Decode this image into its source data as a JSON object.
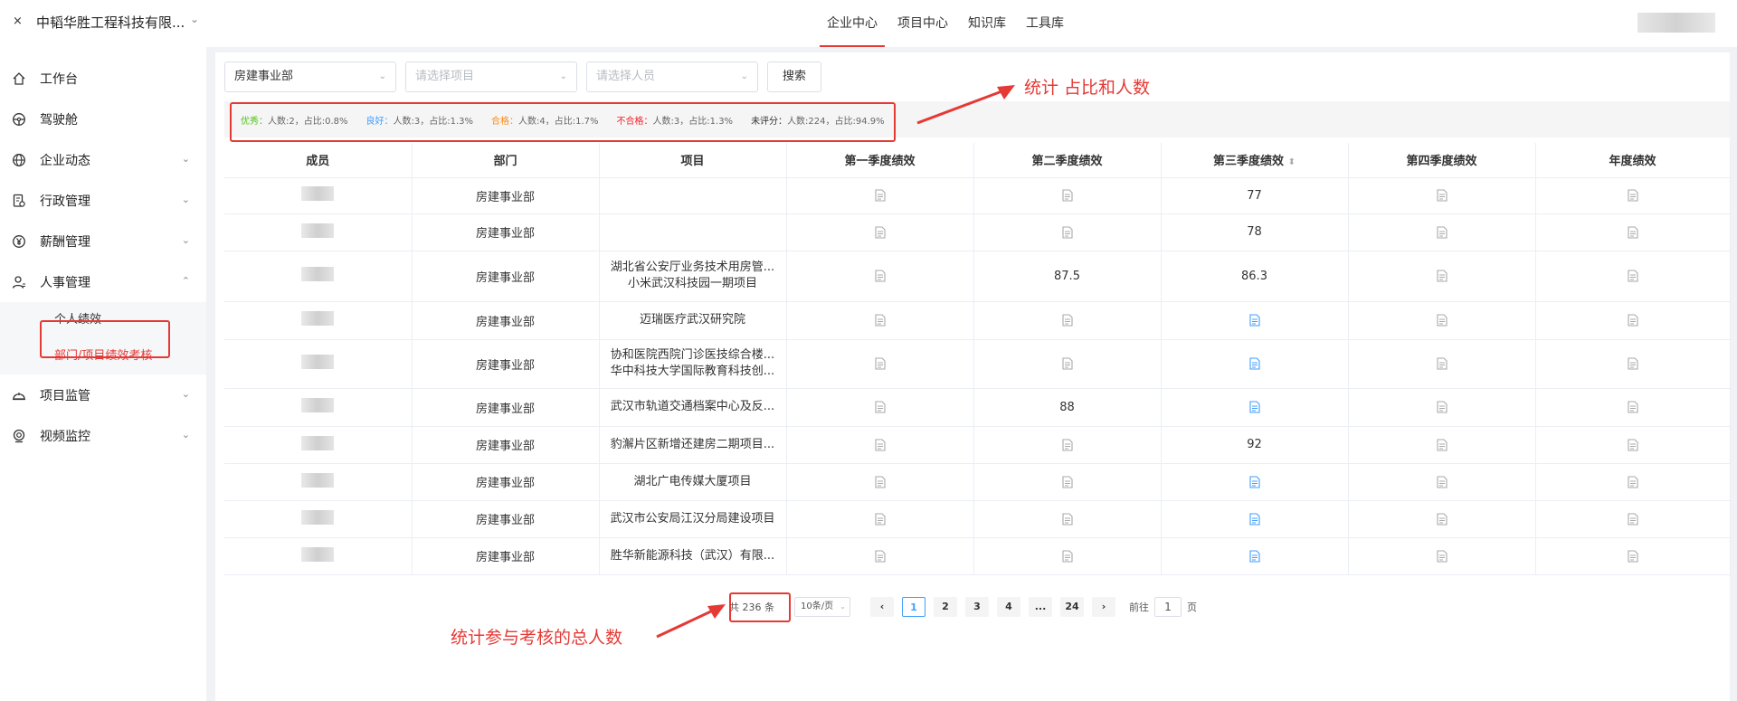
{
  "topbar": {
    "close": "×",
    "company": "中韬华胜工程科技有限...",
    "nav": [
      "企业中心",
      "项目中心",
      "知识库",
      "工具库"
    ]
  },
  "sidebar": {
    "items": [
      {
        "label": "工作台",
        "icon": "home-icon"
      },
      {
        "label": "驾驶舱",
        "icon": "dashboard-icon"
      },
      {
        "label": "企业动态",
        "icon": "globe-icon"
      },
      {
        "label": "行政管理",
        "icon": "admin-icon"
      },
      {
        "label": "薪酬管理",
        "icon": "yen-icon"
      },
      {
        "label": "人事管理",
        "icon": "person-icon"
      },
      {
        "label": "项目监管",
        "icon": "helmet-icon"
      },
      {
        "label": "视频监控",
        "icon": "camera-icon"
      }
    ],
    "sub_items": [
      "个人绩效",
      "部门/项目绩效考核"
    ]
  },
  "filters": {
    "department": "房建事业部",
    "project_placeholder": "请选择项目",
    "person_placeholder": "请选择人员",
    "search": "搜索"
  },
  "stats": [
    {
      "label": "优秀：",
      "text": "人数:2，占比:0.8%"
    },
    {
      "label": "良好：",
      "text": "人数:3，占比:1.3%"
    },
    {
      "label": "合格：",
      "text": "人数:4，占比:1.7%"
    },
    {
      "label": "不合格：",
      "text": "人数:3，占比:1.3%"
    },
    {
      "label": "未评分：",
      "text": "人数:224，占比:94.9%"
    }
  ],
  "table": {
    "headers": [
      "成员",
      "部门",
      "项目",
      "第一季度绩效",
      "第二季度绩效",
      "第三季度绩效",
      "第四季度绩效",
      "年度绩效"
    ],
    "sort_icon": "⬍",
    "rows": [
      {
        "dept": "房建事业部",
        "project": [],
        "q2": "",
        "q3": "77"
      },
      {
        "dept": "房建事业部",
        "project": [],
        "q2": "",
        "q3": "78"
      },
      {
        "dept": "房建事业部",
        "project": [
          "湖北省公安厅业务技术用房管...",
          "小米武汉科技园一期项目"
        ],
        "q2": "87.5",
        "q3": "86.3"
      },
      {
        "dept": "房建事业部",
        "project": [
          "迈瑞医疗武汉研究院"
        ],
        "q2": "",
        "q3": ""
      },
      {
        "dept": "房建事业部",
        "project": [
          "协和医院西院门诊医技综合楼...",
          "华中科技大学国际教育科技创..."
        ],
        "q2": "",
        "q3": ""
      },
      {
        "dept": "房建事业部",
        "project": [
          "武汉市轨道交通档案中心及反..."
        ],
        "q2": "88",
        "q3": ""
      },
      {
        "dept": "房建事业部",
        "project": [
          "豹澥片区新增还建房二期项目..."
        ],
        "q2": "",
        "q3": "92"
      },
      {
        "dept": "房建事业部",
        "project": [
          "湖北广电传媒大厦项目"
        ],
        "q2": "",
        "q3": ""
      },
      {
        "dept": "房建事业部",
        "project": [
          "武汉市公安局江汉分局建设项目"
        ],
        "q2": "",
        "q3": ""
      },
      {
        "dept": "房建事业部",
        "project": [
          "胜华新能源科技（武汉）有限..."
        ],
        "q2": "",
        "q3": ""
      }
    ]
  },
  "pager": {
    "total": "共 236 条",
    "page_size": "10条/页",
    "prev": "‹",
    "next": "›",
    "pages": [
      "1",
      "2",
      "3",
      "4",
      "...",
      "24"
    ],
    "goto_label": "前往",
    "goto_value": "1",
    "goto_suffix": "页"
  },
  "annotations": {
    "stats_note": "统计 占比和人数",
    "total_note": "统计参与考核的总人数"
  },
  "colors": {
    "accent": "#e53935",
    "link": "#409eff",
    "excellent": "#52c41a",
    "good": "#409eff",
    "pass": "#fa8c16",
    "fail": "#f5222d"
  }
}
